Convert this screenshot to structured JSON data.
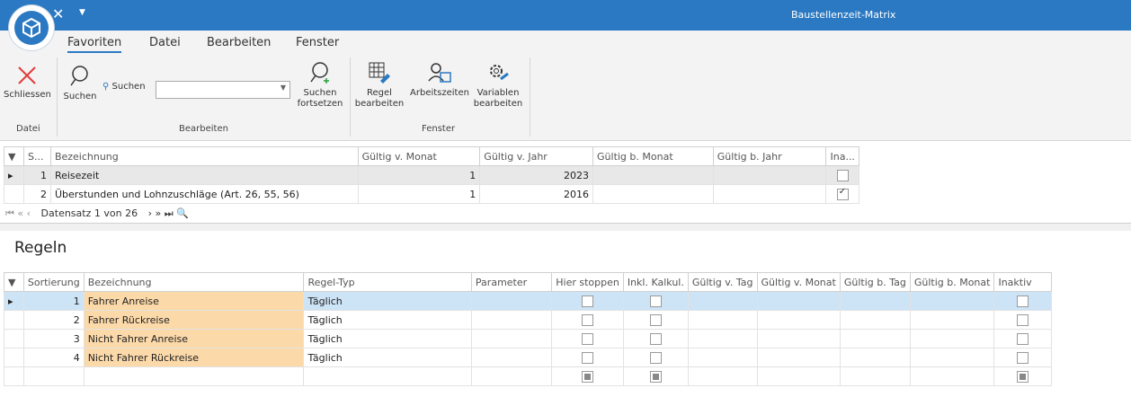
{
  "window": {
    "title": "Baustellenzeit-Matrix"
  },
  "menu": {
    "tabs": [
      "Favoriten",
      "Datei",
      "Bearbeiten",
      "Fenster"
    ]
  },
  "ribbon": {
    "schliessen": "Schliessen",
    "suchen": "Suchen",
    "suchen_label": "Suchen",
    "suchen_fortsetzen": [
      "Suchen",
      "fortsetzen"
    ],
    "regel_bearbeiten": [
      "Regel",
      "bearbeiten"
    ],
    "arbeitszeiten": "Arbeitszeiten",
    "variablen_bearbeiten": [
      "Variablen",
      "bearbeiten"
    ],
    "groups": {
      "datei": "Datei",
      "bearbeiten": "Bearbeiten",
      "fenster": "Fenster"
    }
  },
  "top_grid": {
    "columns": [
      "S...",
      "Bezeichnung",
      "Gültig v. Monat",
      "Gültig v. Jahr",
      "Gültig b. Monat",
      "Gültig b. Jahr",
      "Ina..."
    ],
    "rows": [
      {
        "s": "1",
        "bezeichnung": "Reisezeit",
        "gv_monat": "1",
        "gv_jahr": "2023",
        "gb_monat": "",
        "gb_jahr": "",
        "inaktiv": false
      },
      {
        "s": "2",
        "bezeichnung": "Überstunden und Lohnzuschläge (Art. 26, 55, 56)",
        "gv_monat": "1",
        "gv_jahr": "2016",
        "gb_monat": "",
        "gb_jahr": "",
        "inaktiv": true
      }
    ],
    "nav": "Datensatz 1 von 26"
  },
  "regeln": {
    "title": "Regeln",
    "columns": [
      "Sortierung",
      "Bezeichnung",
      "Regel-Typ",
      "Parameter",
      "Hier stoppen",
      "Inkl. Kalkul.",
      "Gültig v. Tag",
      "Gültig v. Monat",
      "Gültig b. Tag",
      "Gültig b. Monat",
      "Inaktiv"
    ],
    "rows": [
      {
        "sort": "1",
        "bezeichnung": "Fahrer Anreise",
        "typ": "Täglich"
      },
      {
        "sort": "2",
        "bezeichnung": "Fahrer Rückreise",
        "typ": "Täglich"
      },
      {
        "sort": "3",
        "bezeichnung": "Nicht Fahrer Anreise",
        "typ": "Täglich"
      },
      {
        "sort": "4",
        "bezeichnung": "Nicht Fahrer Rückreise",
        "typ": "Täglich"
      }
    ]
  }
}
